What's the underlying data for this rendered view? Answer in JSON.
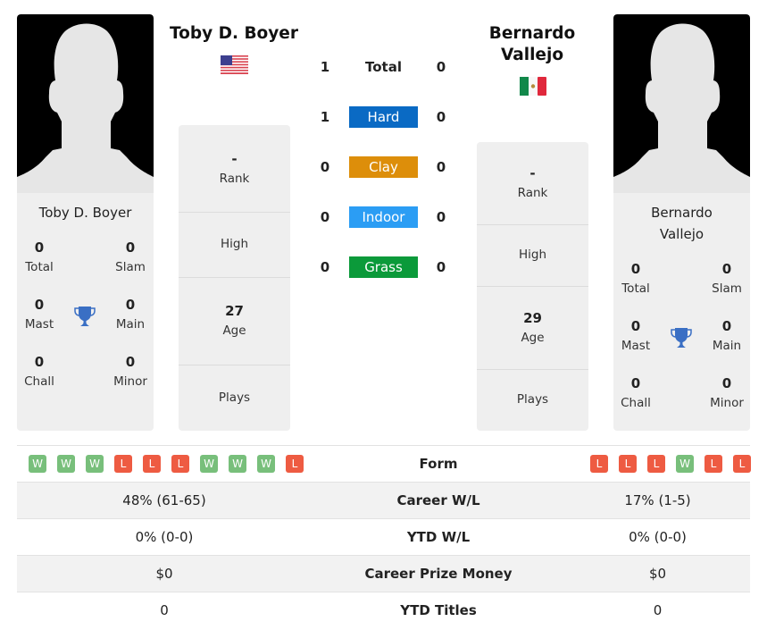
{
  "players": [
    {
      "name": "Toby D. Boyer",
      "name_card": "Toby D. Boyer",
      "header_lines": [
        "Toby D. Boyer"
      ],
      "card_lines": [
        "Toby D. Boyer"
      ],
      "flag": "us-flag-icon",
      "titles": {
        "total": {
          "value": "0",
          "label": "Total"
        },
        "slam": {
          "value": "0",
          "label": "Slam"
        },
        "mast": {
          "value": "0",
          "label": "Mast"
        },
        "main": {
          "value": "0",
          "label": "Main"
        },
        "chall": {
          "value": "0",
          "label": "Chall"
        },
        "minor": {
          "value": "0",
          "label": "Minor"
        }
      },
      "info": {
        "rank": {
          "value": "-",
          "label": "Rank"
        },
        "high": {
          "value": "",
          "label": "High"
        },
        "age": {
          "value": "27",
          "label": "Age"
        },
        "plays": {
          "value": "",
          "label": "Plays"
        }
      },
      "form": [
        "W",
        "W",
        "W",
        "L",
        "L",
        "L",
        "W",
        "W",
        "W",
        "L"
      ]
    },
    {
      "name": "Bernardo Vallejo",
      "header_lines": [
        "Bernardo",
        "Vallejo"
      ],
      "card_lines": [
        "Bernardo",
        "Vallejo"
      ],
      "flag": "mexico-flag-icon",
      "titles": {
        "total": {
          "value": "0",
          "label": "Total"
        },
        "slam": {
          "value": "0",
          "label": "Slam"
        },
        "mast": {
          "value": "0",
          "label": "Mast"
        },
        "main": {
          "value": "0",
          "label": "Main"
        },
        "chall": {
          "value": "0",
          "label": "Chall"
        },
        "minor": {
          "value": "0",
          "label": "Minor"
        }
      },
      "info": {
        "rank": {
          "value": "-",
          "label": "Rank"
        },
        "high": {
          "value": "",
          "label": "High"
        },
        "age": {
          "value": "29",
          "label": "Age"
        },
        "plays": {
          "value": "",
          "label": "Plays"
        }
      },
      "form": [
        "L",
        "L",
        "L",
        "W",
        "L",
        "L"
      ]
    }
  ],
  "h2h": [
    {
      "label": "Total",
      "left": "1",
      "right": "0",
      "color": null
    },
    {
      "label": "Hard",
      "left": "1",
      "right": "0",
      "color": "#0a6ac4"
    },
    {
      "label": "Clay",
      "left": "0",
      "right": "0",
      "color": "#dd8e0a"
    },
    {
      "label": "Indoor",
      "left": "0",
      "right": "0",
      "color": "#2b9df4"
    },
    {
      "label": "Grass",
      "left": "0",
      "right": "0",
      "color": "#0b9a3a"
    }
  ],
  "stats": [
    {
      "label": "Form",
      "left": "",
      "right": ""
    },
    {
      "label": "Career W/L",
      "left": "48% (61-65)",
      "right": "17% (1-5)"
    },
    {
      "label": "YTD W/L",
      "left": "0% (0-0)",
      "right": "0% (0-0)"
    },
    {
      "label": "Career Prize Money",
      "left": "$0",
      "right": "$0"
    },
    {
      "label": "YTD Titles",
      "left": "0",
      "right": "0"
    }
  ],
  "colors": {
    "win": "#78bf7b",
    "loss": "#ee5b42",
    "trophy": "#3a6fc4"
  }
}
